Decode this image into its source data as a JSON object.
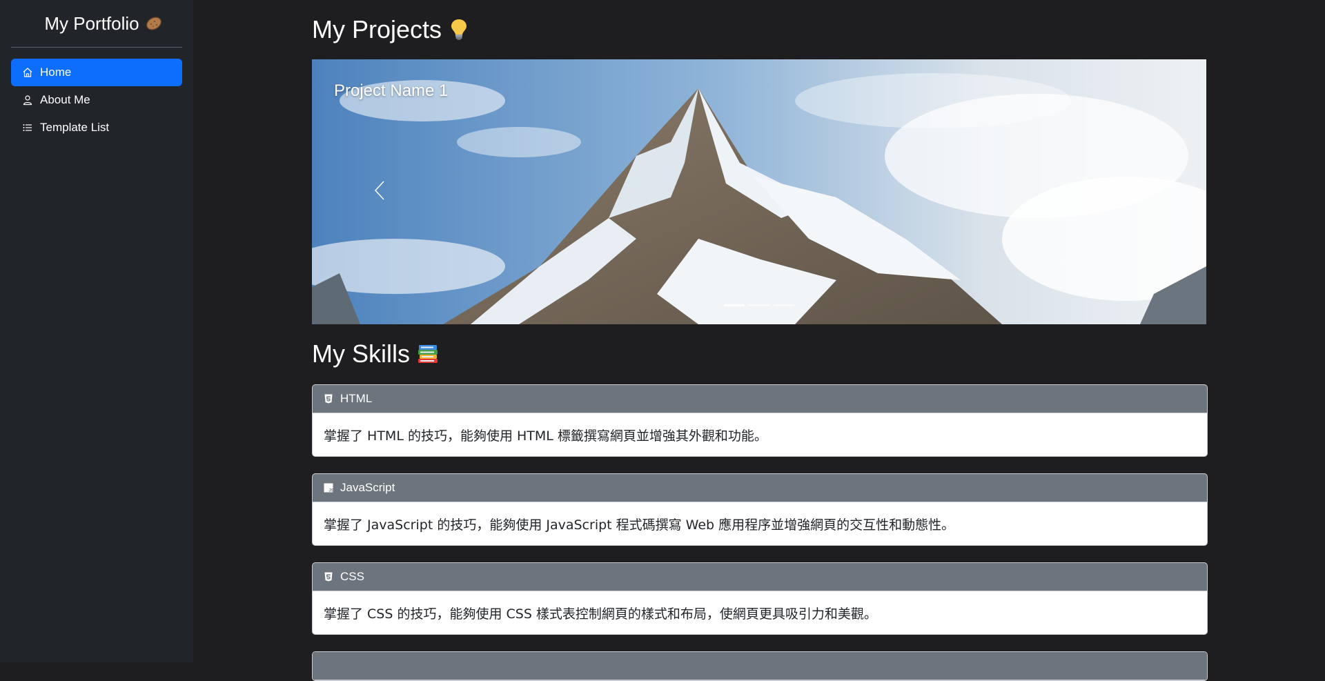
{
  "sidebar": {
    "brand": "My Portfolio",
    "brand_icon": "potato-emoji",
    "items": [
      {
        "label": "Home",
        "icon": "house-icon",
        "active": true
      },
      {
        "label": "About Me",
        "icon": "person-icon",
        "active": false
      },
      {
        "label": "Template List",
        "icon": "list-icon",
        "active": false
      }
    ]
  },
  "projects": {
    "title": "My Projects",
    "title_icon": "lightbulb-emoji",
    "carousel": {
      "caption": "Project Name 1",
      "slide_count": 3,
      "active_index": 0,
      "image": "mountain-peak-photo"
    }
  },
  "skills": {
    "title": "My Skills",
    "title_icon": "books-emoji",
    "items": [
      {
        "name": "HTML",
        "icon": "html5-icon",
        "description": "掌握了 HTML 的技巧，能夠使用 HTML 標籤撰寫網頁並增強其外觀和功能。"
      },
      {
        "name": "JavaScript",
        "icon": "javascript-icon",
        "description": "掌握了 JavaScript 的技巧，能夠使用 JavaScript 程式碼撰寫 Web 應用程序並增強網頁的交互性和動態性。"
      },
      {
        "name": "CSS",
        "icon": "css3-icon",
        "description": "掌握了 CSS 的技巧，能夠使用 CSS 樣式表控制網頁的樣式和布局，使網頁更具吸引力和美觀。"
      }
    ]
  },
  "colors": {
    "page_bg": "#1e1e20",
    "sidebar_bg": "#212529",
    "active": "#0d6efd",
    "card_header": "#6c757d"
  }
}
